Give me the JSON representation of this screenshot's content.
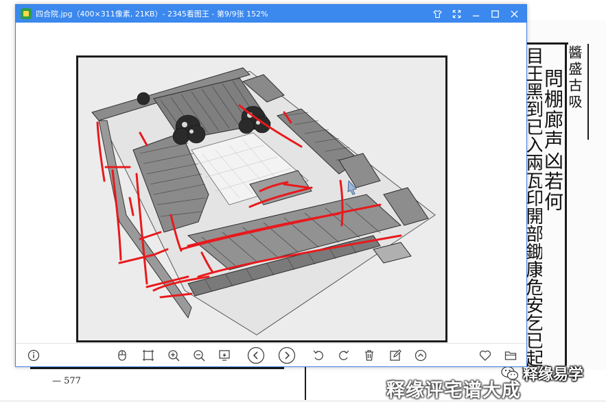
{
  "window": {
    "title": "四合院.jpg（400×311像素, 21KB）- 2345看图王 - 第9/9张 152%",
    "accent_color": "#3b88ee",
    "controls": [
      "skin-icon",
      "fullscreen-icon",
      "minimize-icon",
      "maximize-icon",
      "close-icon"
    ]
  },
  "image": {
    "subject": "siheyuan courtyard house sketch with red annotation strokes",
    "annotation_color": "#e8191c"
  },
  "toolbar": {
    "left": [
      "info-icon"
    ],
    "center": [
      "mouse-icon",
      "actual-size-icon",
      "zoom-in-icon",
      "zoom-out-icon",
      "screenshot-icon",
      "prev-icon",
      "next-icon",
      "rotate-left-icon",
      "rotate-right-icon",
      "delete-icon",
      "edit-icon",
      "upload-icon"
    ],
    "right": [
      "favorite-icon",
      "folder-icon"
    ]
  },
  "background": {
    "col1": "問棚廊声凶若何",
    "col2": "目王黑到已入兩瓦印開部鋤康危安乞已起龍類頂利舌人魚",
    "col3": "醬盛古吸",
    "page_number": "— 577",
    "watermark_book": "释缘评宅谱大成",
    "watermark_account": "释缘易学"
  }
}
